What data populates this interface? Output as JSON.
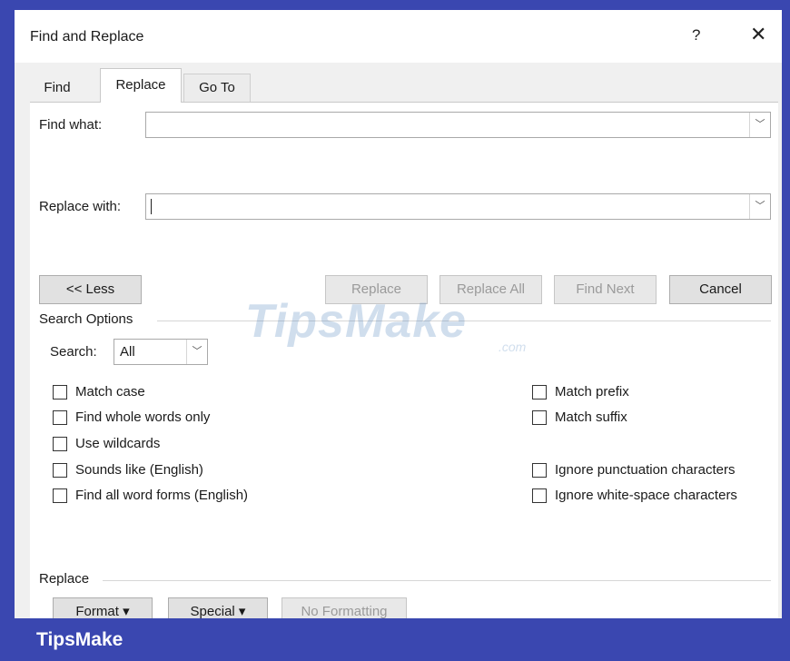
{
  "dialog": {
    "title": "Find and Replace",
    "help_label": "?",
    "close_label": "✕"
  },
  "tabs": [
    {
      "label": "Find",
      "active": false
    },
    {
      "label": "Replace",
      "active": true
    },
    {
      "label": "Go To",
      "active": false
    }
  ],
  "find": {
    "label": "Find what:",
    "value": ""
  },
  "replace": {
    "label": "Replace with:",
    "value": ""
  },
  "buttons": {
    "less": "<< Less",
    "replace": "Replace",
    "replace_all": "Replace All",
    "find_next": "Find Next",
    "cancel": "Cancel"
  },
  "search_options": {
    "heading": "Search Options",
    "search_label": "Search:",
    "search_value": "All",
    "left_options": [
      {
        "label": "Match case",
        "checked": false
      },
      {
        "label": "Find whole words only",
        "checked": false
      },
      {
        "label": "Use wildcards",
        "checked": false
      },
      {
        "label": "Sounds like (English)",
        "checked": false
      },
      {
        "label": "Find all word forms (English)",
        "checked": false
      }
    ],
    "right_options": [
      {
        "label": "Match prefix",
        "checked": false
      },
      {
        "label": "Match suffix",
        "checked": false
      },
      {
        "label": "Ignore punctuation characters",
        "checked": false
      },
      {
        "label": "Ignore white-space characters",
        "checked": false
      }
    ]
  },
  "replace_section": {
    "heading": "Replace",
    "format": "Format ▾",
    "special": "Special ▾",
    "no_formatting": "No Formatting"
  },
  "watermark": {
    "main": "TipsMake",
    "suffix": ".com"
  },
  "banner": {
    "text": "TipsMake"
  },
  "colors": {
    "banner": "#3a47b0",
    "dialog_bg": "#f0f0f0",
    "button_bg": "#e1e1e1"
  }
}
